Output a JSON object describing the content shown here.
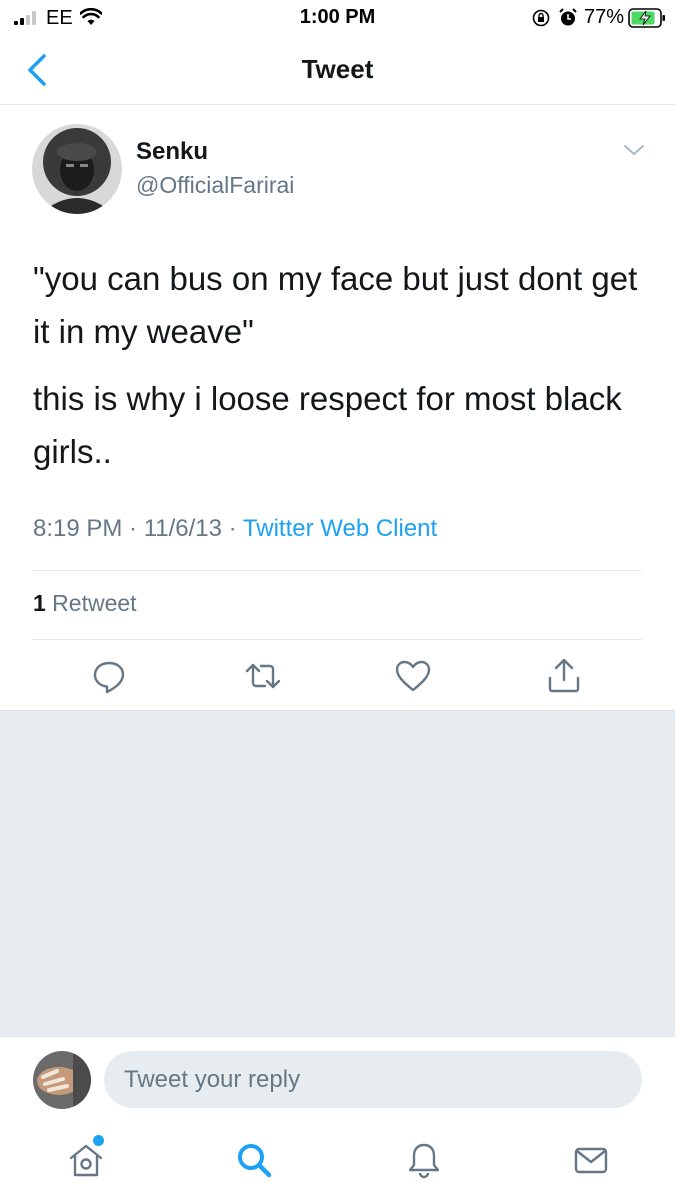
{
  "status_bar": {
    "carrier": "EE",
    "time": "1:00 PM",
    "battery": "77%",
    "icons": [
      "signal-icon",
      "wifi-icon",
      "rotation-lock-icon",
      "alarm-icon",
      "battery-charging-icon"
    ]
  },
  "nav": {
    "title": "Tweet",
    "back_icon": "chevron-left-icon"
  },
  "tweet": {
    "author_name": "Senku",
    "author_handle": "@OfficialFarirai",
    "paragraphs": [
      "\"you can bus on my face but just dont get it in my weave\"",
      "this is why i loose respect for most black girls.."
    ],
    "timestamp": "8:19 PM · 11/6/13 · ",
    "client": "Twitter Web Client",
    "retweet_count": "1",
    "retweet_label": " Retweet",
    "actions": [
      "reply-icon",
      "retweet-icon",
      "like-icon",
      "share-icon"
    ]
  },
  "reply": {
    "placeholder": "Tweet your reply"
  },
  "tab_bar": {
    "items": [
      "home-icon",
      "search-icon",
      "notifications-icon",
      "messages-icon"
    ]
  },
  "colors": {
    "accent": "#1da1f2",
    "secondary_text": "#657786",
    "divider": "#e1e8ed",
    "background_gray": "#e6ecf0"
  }
}
